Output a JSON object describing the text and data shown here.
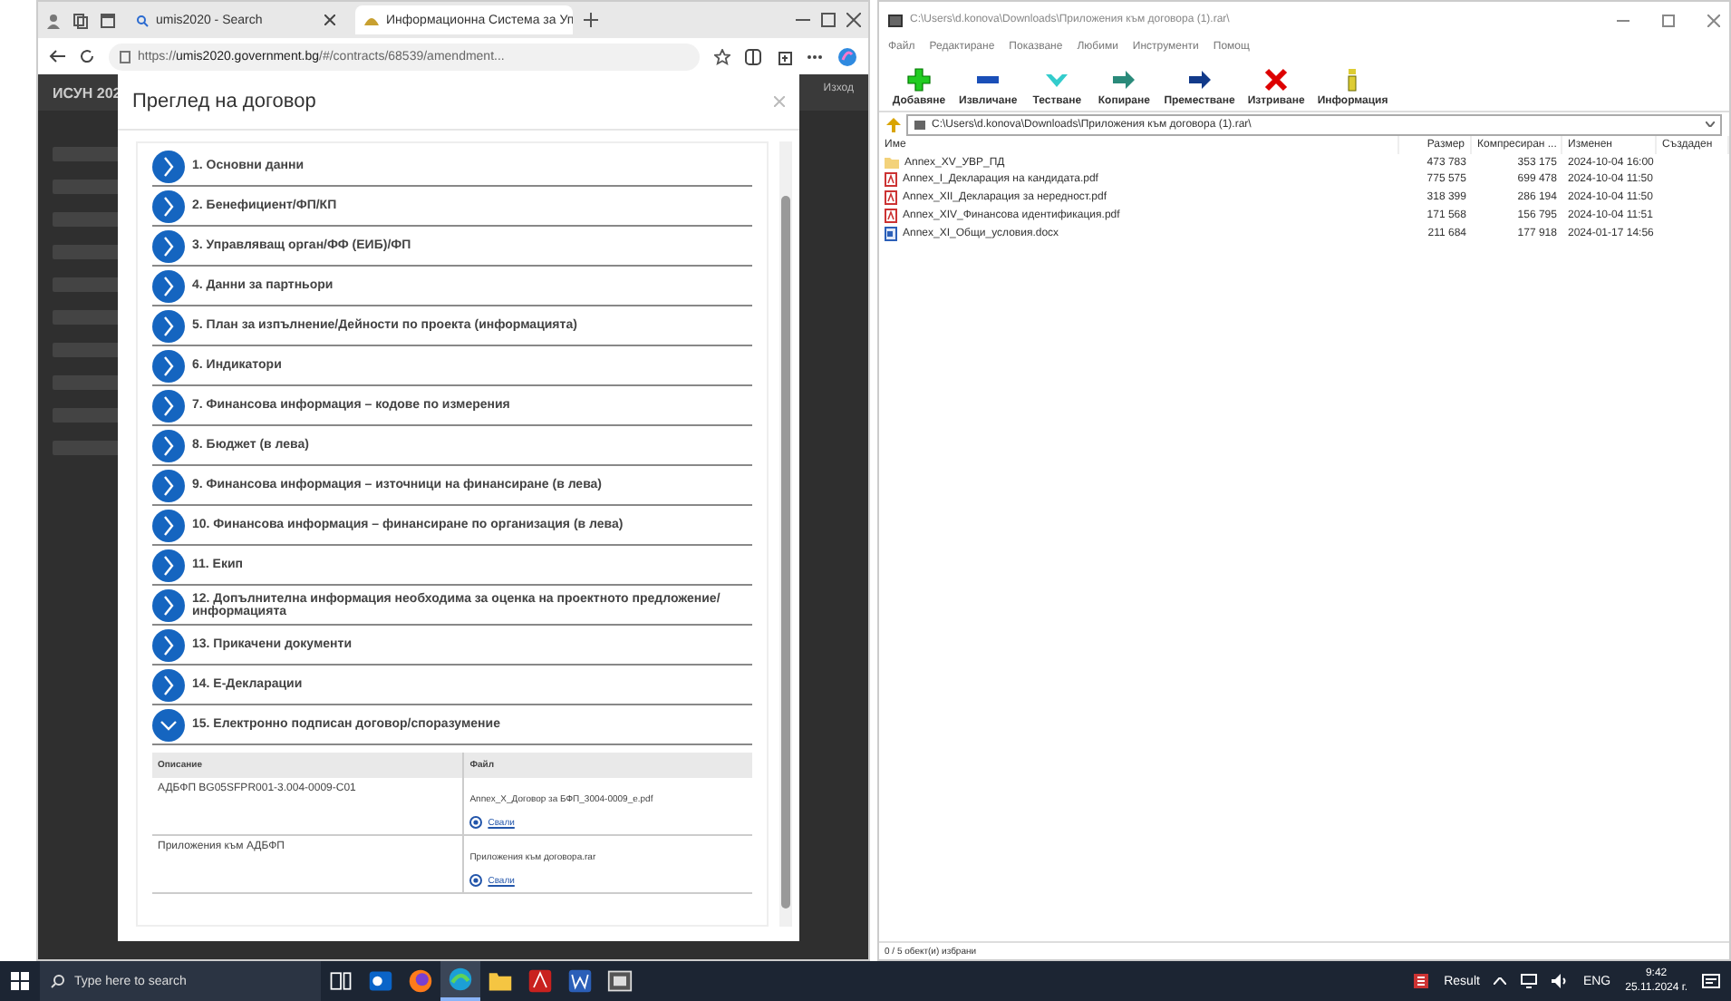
{
  "browser": {
    "tabs": [
      {
        "label": "umis2020 - Search",
        "selected": false
      },
      {
        "label": "Информационна Система за Уп",
        "selected": true
      }
    ],
    "url": {
      "scheme": "https://",
      "host": "umis2020.government.bg",
      "path": "/#/contracts/68539/amendment..."
    }
  },
  "page": {
    "logo": "ИСУН 202",
    "logout": "Изход"
  },
  "modal": {
    "title": "Преглед на договор",
    "sections": [
      {
        "label": "1. Основни данни",
        "expanded": false
      },
      {
        "label": "2. Бенефициент/ФП/КП",
        "expanded": false
      },
      {
        "label": "3. Управляващ орган/ФФ (ЕИБ)/ФП",
        "expanded": false
      },
      {
        "label": "4. Данни за партньори",
        "expanded": false
      },
      {
        "label": "5. План за изпълнение/Дейности по проекта (информацията)",
        "expanded": false
      },
      {
        "label": "6. Индикатори",
        "expanded": false
      },
      {
        "label": "7. Финансова информация – кодове по измерения",
        "expanded": false
      },
      {
        "label": "8. Бюджет (в лева)",
        "expanded": false
      },
      {
        "label": "9. Финансова информация – източници на финансиране (в лева)",
        "expanded": false
      },
      {
        "label": "10. Финансова информация – финансиране по организация (в лева)",
        "expanded": false
      },
      {
        "label": "11. Екип",
        "expanded": false
      },
      {
        "label": "12. Допълнителна информация необходима за оценка на проектното предложение/ информацията",
        "expanded": false
      },
      {
        "label": "13. Прикачени документи",
        "expanded": false
      },
      {
        "label": "14. Е-Декларации",
        "expanded": false
      },
      {
        "label": "15. Електронно подписан договор/споразумение",
        "expanded": true
      }
    ],
    "table": {
      "columns": [
        "Описание",
        "Файл"
      ],
      "rows": [
        {
          "description": "АДБФП BG05SFPR001-3.004-0009-C01",
          "file": "Annex_X_Договор за БФП_3004-0009_e.pdf",
          "link": "Свали"
        },
        {
          "description": "Приложения към АДБФП",
          "file": "Приложения към договора.rar",
          "link": "Свали"
        }
      ]
    }
  },
  "archiver": {
    "title": "C:\\Users\\d.konova\\Downloads\\Приложения към договора (1).rar\\",
    "menu": [
      "Файл",
      "Редактиране",
      "Показване",
      "Любими",
      "Инструменти",
      "Помощ"
    ],
    "tools": [
      {
        "kind": "add",
        "label": "Добавяне"
      },
      {
        "kind": "extract",
        "label": "Извличане"
      },
      {
        "kind": "test",
        "label": "Тестване"
      },
      {
        "kind": "copy",
        "label": "Копиране"
      },
      {
        "kind": "move",
        "label": "Преместване"
      },
      {
        "kind": "delete",
        "label": "Изтриване"
      },
      {
        "kind": "info",
        "label": "Информация"
      }
    ],
    "path": "C:\\Users\\d.konova\\Downloads\\Приложения към договора (1).rar\\",
    "columns": [
      "Име",
      "Размер",
      "Компресиран ...",
      "Изменен",
      "Създаден"
    ],
    "files": [
      {
        "kind": "folder",
        "name": "Annex_XV_УВР_ПД",
        "size": "473 783",
        "packed": "353 175",
        "modified": "2024-10-04 16:00"
      },
      {
        "kind": "pdf",
        "name": "Annex_I_Декларация на кандидата.pdf",
        "size": "775 575",
        "packed": "699 478",
        "modified": "2024-10-04 11:50"
      },
      {
        "kind": "pdf",
        "name": "Annex_XII_Декларация за нередност.pdf",
        "size": "318 399",
        "packed": "286 194",
        "modified": "2024-10-04 11:50"
      },
      {
        "kind": "pdf",
        "name": "Annex_XIV_Финансова идентификация.pdf",
        "size": "171 568",
        "packed": "156 795",
        "modified": "2024-10-04 11:51"
      },
      {
        "kind": "docx",
        "name": "Annex_XI_Общи_условия.docx",
        "size": "211 684",
        "packed": "177 918",
        "modified": "2024-01-17 14:56"
      }
    ],
    "status": "0 / 5 обект(и) избрани"
  },
  "taskbar": {
    "search": "Type here to search",
    "apps": [
      {
        "kind": "taskview",
        "selected": false
      },
      {
        "kind": "outlook",
        "selected": false
      },
      {
        "kind": "firefox",
        "selected": false
      },
      {
        "kind": "edge",
        "selected": true
      },
      {
        "kind": "explorer",
        "selected": false
      },
      {
        "kind": "acrobat",
        "selected": false
      },
      {
        "kind": "word",
        "selected": false
      },
      {
        "kind": "winrar",
        "selected": false
      }
    ],
    "result": "Result",
    "lang": "ENG",
    "time": "9:42",
    "date": "25.11.2024 г."
  }
}
